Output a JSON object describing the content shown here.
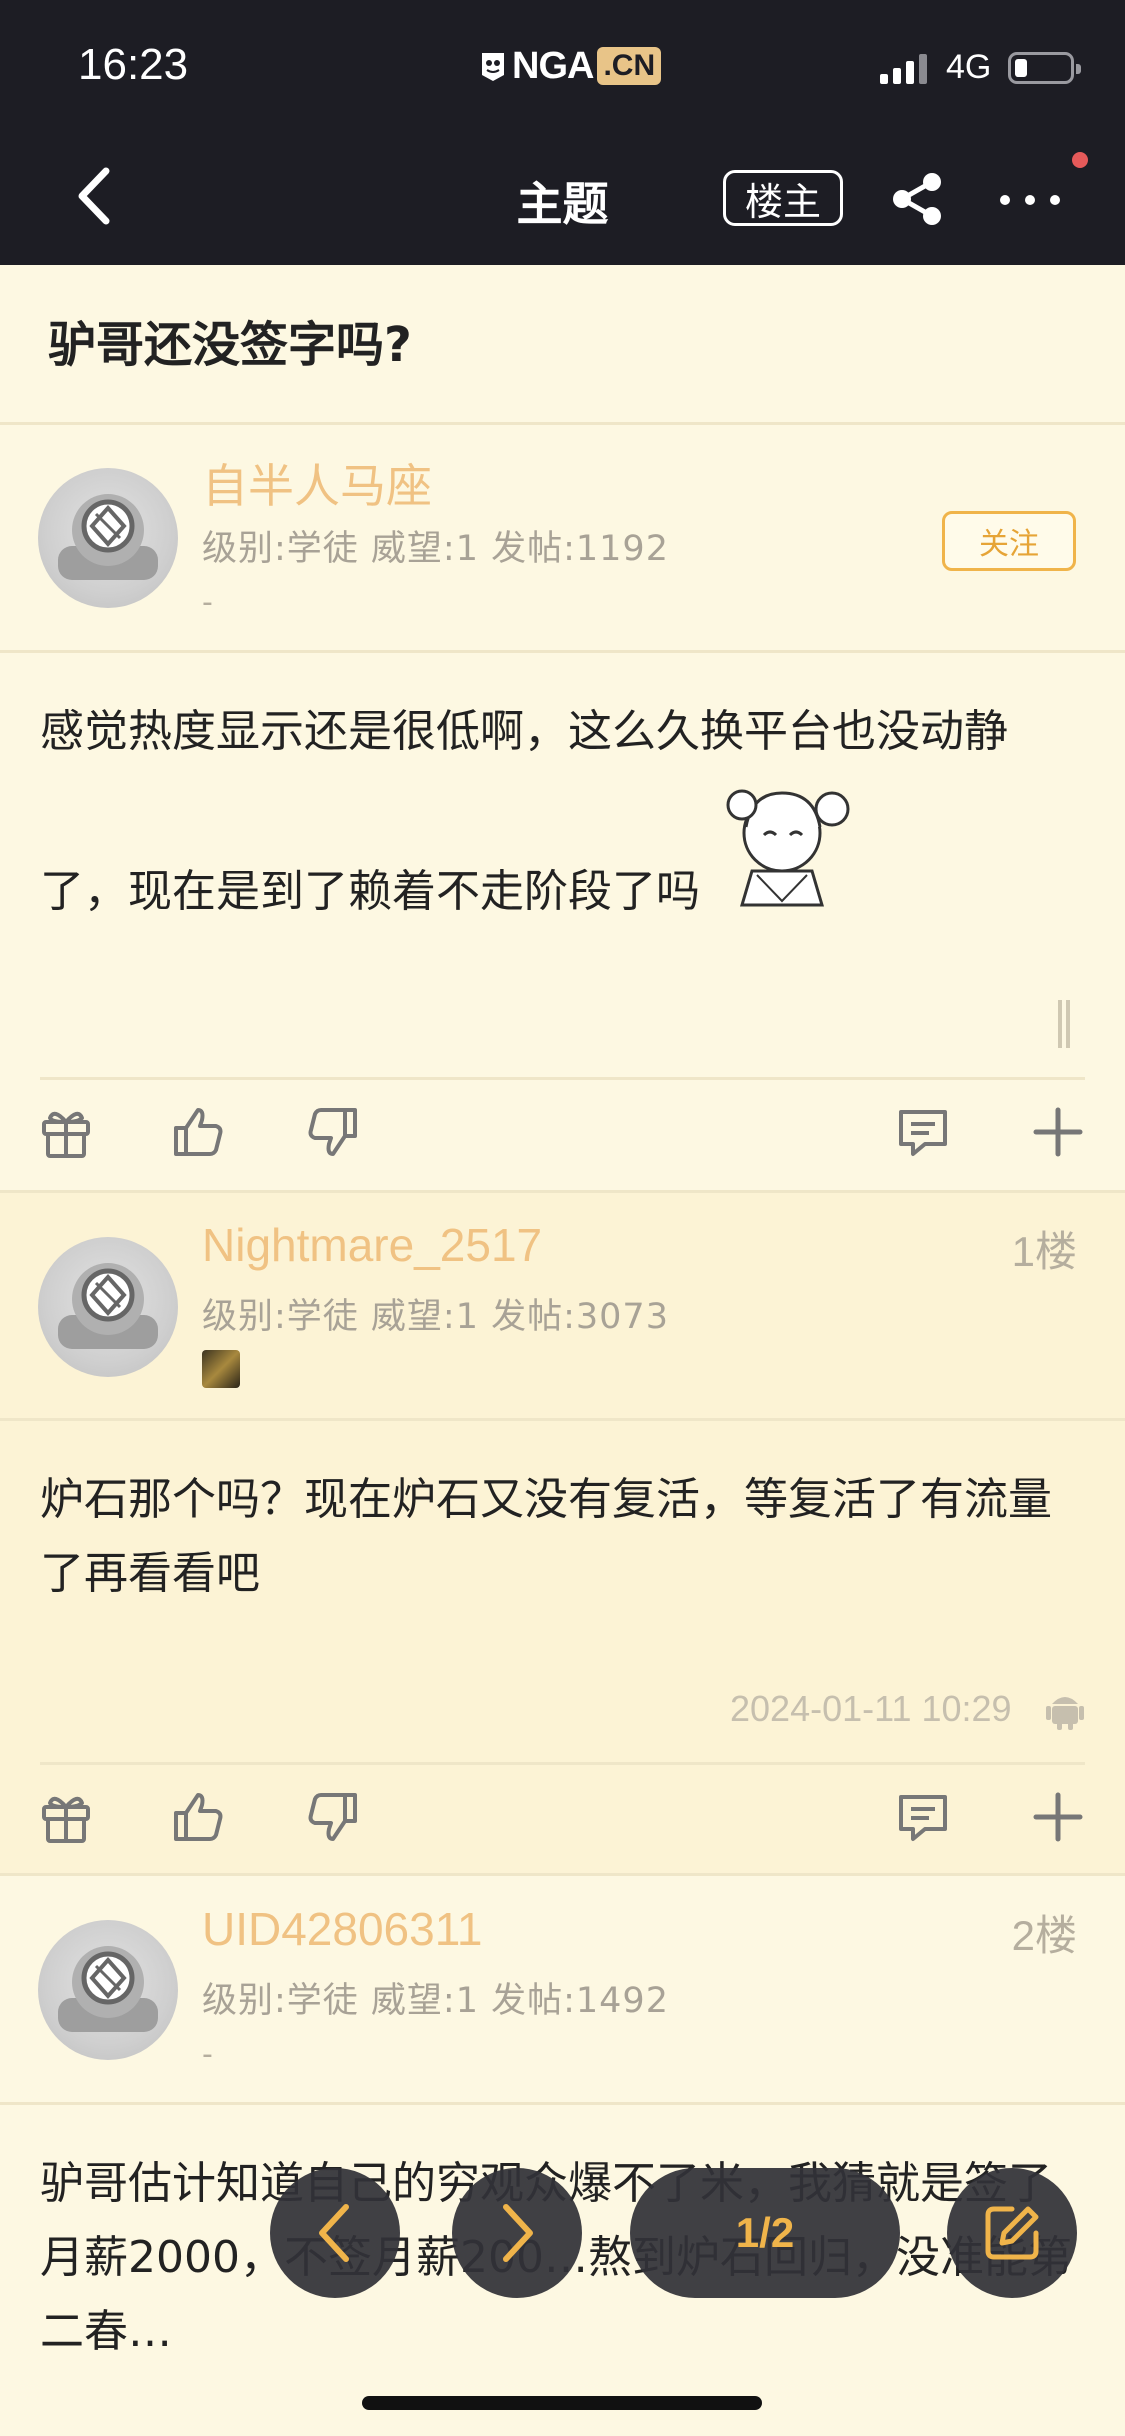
{
  "status_bar": {
    "time": "16:23",
    "logo_main": "NGA",
    "logo_suffix": ".CN",
    "network": "4G"
  },
  "nav": {
    "title": "主题",
    "op_label": "楼主"
  },
  "thread": {
    "title": "驴哥还没签字吗?"
  },
  "posts": [
    {
      "username": "自半人马座",
      "meta": "级别:学徒   威望:1   发帖:1192",
      "sub": "-",
      "follow_label": "关注",
      "content_line1": "感觉热度显示还是很低啊，这么久换平台也没动静",
      "content_line2": "了，现在是到了赖着不走阶段了吗"
    },
    {
      "username": "Nightmare_2517",
      "meta": "级别:学徒   威望:1   发帖:3073",
      "floor": "1楼",
      "content_line1": "炉石那个吗？现在炉石又没有复活，等复活了有流量",
      "content_line2": "了再看看吧",
      "timestamp": "2024-01-11 10:29"
    },
    {
      "username": "UID42806311",
      "meta": "级别:学徒   威望:1   发帖:1492",
      "sub": "-",
      "floor": "2楼",
      "content_line1": "驴哥估计知道自己的穷观众爆不了米，我猜就是签了",
      "content_line2": "月薪2000，不签月薪200…熬到炉石回归，没准能第",
      "content_line3": "二春…"
    }
  ],
  "pager": {
    "indicator": "1/2"
  },
  "icons": [
    "back-icon",
    "share-icon",
    "more-icon",
    "gift-icon",
    "thumbs-up-icon",
    "thumbs-down-icon",
    "comment-icon",
    "plus-icon",
    "android-icon",
    "prev-icon",
    "next-icon",
    "edit-icon"
  ],
  "colors": {
    "topbar": "#1d1d24",
    "background": "#fdf8e2",
    "reply_background": "#fcf3d5",
    "username": "#f0c283",
    "accent": "#f0b44a"
  }
}
